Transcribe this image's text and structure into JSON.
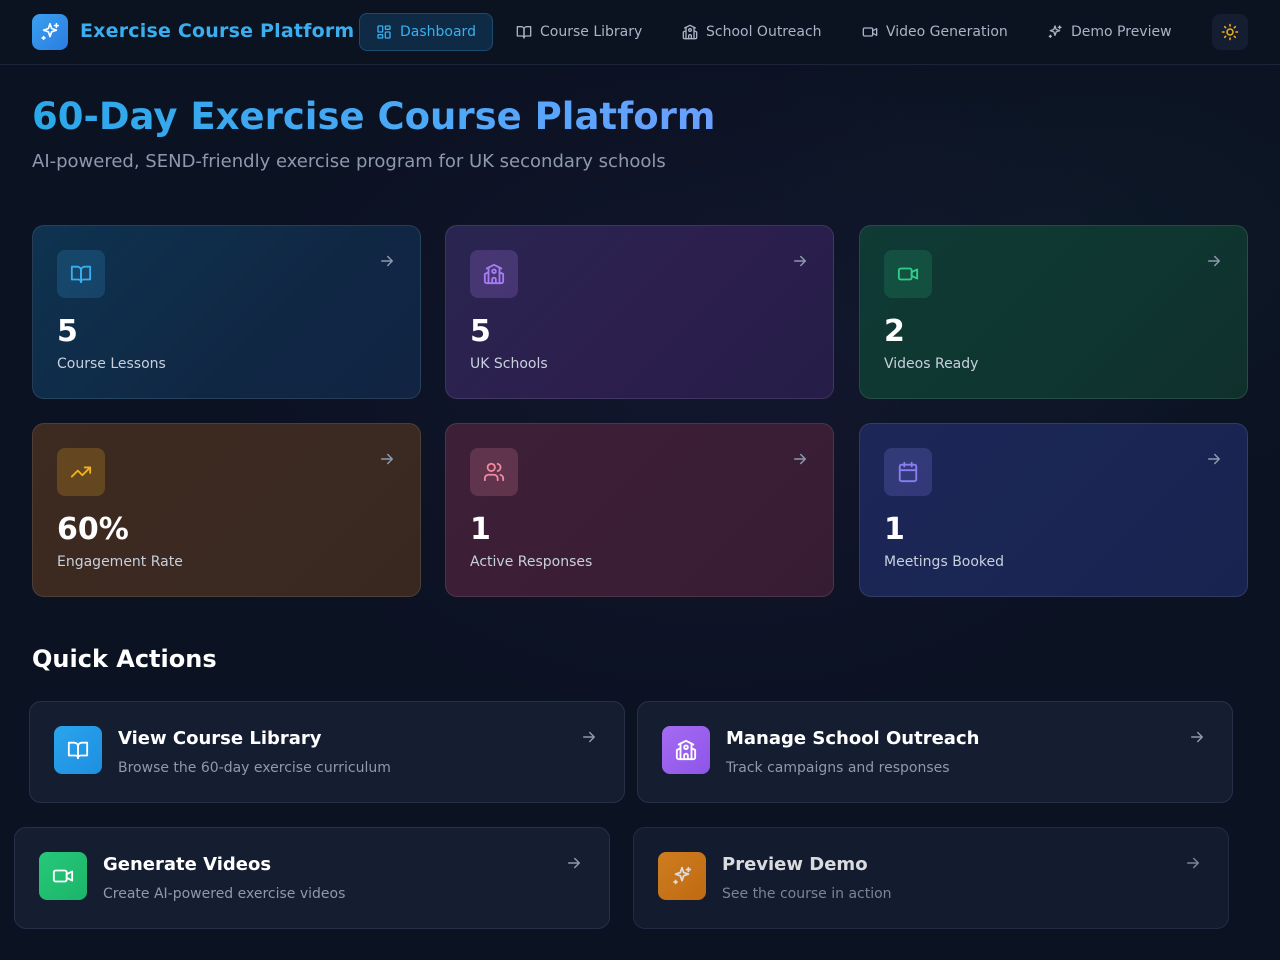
{
  "header": {
    "app_title": "Exercise Course Platform",
    "logo_icon": "sparkles-icon",
    "nav": [
      {
        "label": "Dashboard",
        "icon": "layout-dashboard-icon",
        "active": true
      },
      {
        "label": "Course Library",
        "icon": "book-open-icon",
        "active": false
      },
      {
        "label": "School Outreach",
        "icon": "school-icon",
        "active": false
      },
      {
        "label": "Video Generation",
        "icon": "video-icon",
        "active": false
      },
      {
        "label": "Demo Preview",
        "icon": "sparkles-icon",
        "active": false
      }
    ],
    "theme_icon": "sun-icon"
  },
  "hero": {
    "title": "60-Day Exercise Course Platform",
    "subtitle": "AI-powered, SEND-friendly exercise program for UK secondary schools"
  },
  "stats": [
    {
      "value": "5",
      "label": "Course Lessons",
      "icon": "book-open-icon",
      "color": "#3aaeef"
    },
    {
      "value": "5",
      "label": "UK Schools",
      "icon": "school-icon",
      "color": "#a77bf3"
    },
    {
      "value": "2",
      "label": "Videos Ready",
      "icon": "video-icon",
      "color": "#2ecf8a"
    },
    {
      "value": "60%",
      "label": "Engagement Rate",
      "icon": "trending-up-icon",
      "color": "#f2b21e"
    },
    {
      "value": "1",
      "label": "Active Responses",
      "icon": "users-icon",
      "color": "#f08aa0"
    },
    {
      "value": "1",
      "label": "Meetings Booked",
      "icon": "calendar-icon",
      "color": "#8a7ff2"
    }
  ],
  "quick_actions": {
    "title": "Quick Actions",
    "items": [
      {
        "title": "View Course Library",
        "description": "Browse the 60-day exercise curriculum",
        "icon": "book-open-icon",
        "color": "#2aa4ec"
      },
      {
        "title": "Manage School Outreach",
        "description": "Track campaigns and responses",
        "icon": "school-icon",
        "color": "#9a63ee"
      },
      {
        "title": "Generate Videos",
        "description": "Create AI-powered exercise videos",
        "icon": "video-icon",
        "color": "#22c074"
      },
      {
        "title": "Preview Demo",
        "description": "See the course in action",
        "icon": "sparkles-icon",
        "color": "#ee8a1c"
      }
    ]
  }
}
